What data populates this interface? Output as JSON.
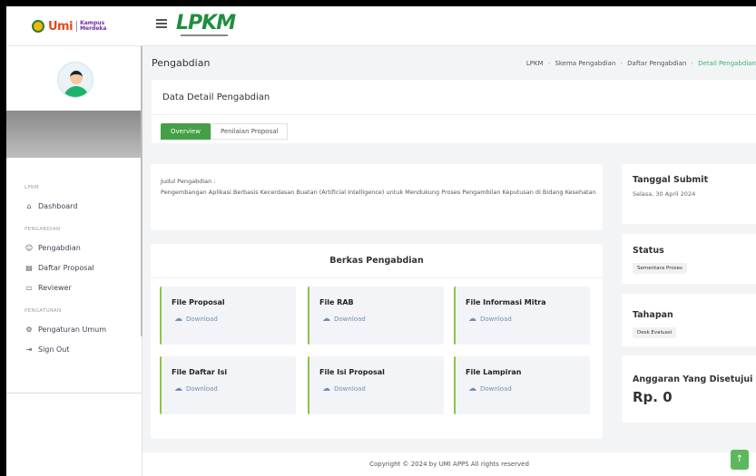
{
  "header": {
    "logo_umi": "Umi",
    "logo_km_line1": "Kampus",
    "logo_km_line2": "Merdeka",
    "brand": "LPKM"
  },
  "sidebar": {
    "sections": [
      {
        "label": "LPKM",
        "items": [
          {
            "label": "Dashboard",
            "icon": "home-icon"
          }
        ]
      },
      {
        "label": "PENGABDIAN",
        "items": [
          {
            "label": "Pengabdian",
            "icon": "users-icon"
          },
          {
            "label": "Daftar Proposal",
            "icon": "document-icon"
          },
          {
            "label": "Reviewer",
            "icon": "chat-icon"
          }
        ]
      },
      {
        "label": "PENGATURAN",
        "items": [
          {
            "label": "Pengaturan Umum",
            "icon": "settings-icon"
          },
          {
            "label": "Sign Out",
            "icon": "sign-out-icon"
          }
        ]
      }
    ]
  },
  "page": {
    "heading": "Pengabdian",
    "breadcrumbs": [
      "LPKM",
      "Skema Pengabdian",
      "Daftar Pengabdian",
      "Detail Pengabdian"
    ],
    "detail_title": "Data Detail Pengabdian",
    "tabs": [
      {
        "label": "Overview",
        "active": true
      },
      {
        "label": "Penilaian Proposal",
        "active": false
      }
    ]
  },
  "judul": {
    "label": "Judul Pengabdian :",
    "text": "Pengembangan Aplikasi Berbasis Kecerdasan Buatan (Artificial Intelligence) untuk Mendukung Proses Pengambilan Keputusan di Bidang Kesehatan"
  },
  "berkas": {
    "title": "Berkas Pengabdian",
    "download_label": "Download",
    "files": [
      "File Proposal",
      "File RAB",
      "File Informasi Mitra",
      "File Daftar Isi",
      "File Isi Proposal",
      "File Lampiran"
    ]
  },
  "info": {
    "tanggal_title": "Tanggal Submit",
    "tanggal_value": "Selasa, 30 April 2024",
    "status_title": "Status",
    "status_value": "Sementara Proses",
    "tahapan_title": "Tahapan",
    "tahapan_value": "Desk Evaluasi",
    "anggaran_title": "Anggaran Yang Disetujui",
    "anggaran_value": "Rp. 0"
  },
  "footer": {
    "text": "Copyright © 2024 by UMI APPS All rights reserved",
    "to_top": "↑"
  },
  "colors": {
    "accent": "#43a047",
    "brand": "#1e8e3e"
  }
}
